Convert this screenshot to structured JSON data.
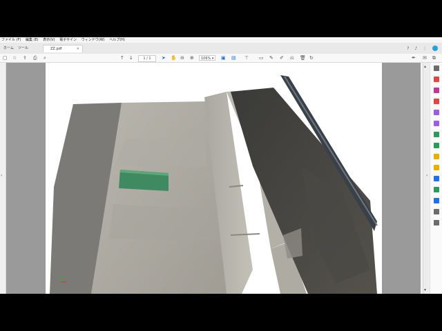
{
  "menu": [
    "ファイル (F)",
    "編集 (E)",
    "表示(V)",
    "電子サイン",
    "ウィンドウ(W)",
    "ヘルプ(H)"
  ],
  "tabs": {
    "home": "ホーム",
    "tools": "ツール",
    "document": "ZZ.pdf"
  },
  "toolbar": {
    "page_current": "1",
    "page_total": "/ 1",
    "zoom": "106%"
  },
  "colors": {
    "accent": "#27a0d8",
    "page_bg": "#ffffff",
    "workspace": "#9a9a9a"
  },
  "right_panel_icons": [
    "search-icon",
    "export-pdf-icon",
    "edit-pdf-icon",
    "create-pdf-icon",
    "comment-icon",
    "organize-pages-icon",
    "combine-icon",
    "scan-icon",
    "fill-sign-icon",
    "request-signature-icon",
    "protect-icon",
    "more-tools-icon",
    "print-production-icon",
    "redact-icon",
    "settings-icon"
  ]
}
